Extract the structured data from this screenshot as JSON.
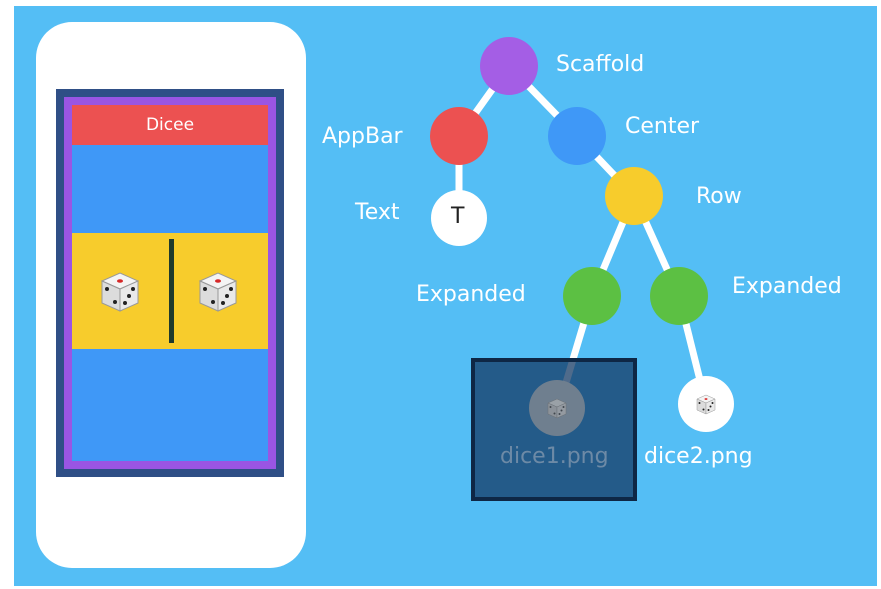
{
  "phone": {
    "appbar_title": "Dicee"
  },
  "tree": {
    "nodes": {
      "scaffold": "Scaffold",
      "appbar": "AppBar",
      "center": "Center",
      "text": "Text",
      "text_node_glyph": "T",
      "row": "Row",
      "expanded_left": "Expanded",
      "expanded_right": "Expanded",
      "image_left": "dice1.png",
      "image_right": "dice2.png"
    }
  },
  "colors": {
    "background": "#54bef5",
    "scaffold": "#a45ee5",
    "appbar": "#ec5151",
    "center": "#3f98f7",
    "row": "#f7cc2c",
    "expanded": "#5cc043",
    "text_node": "#ffffff",
    "highlight": "#143a64"
  },
  "icons": {
    "die": "dice-icon"
  }
}
